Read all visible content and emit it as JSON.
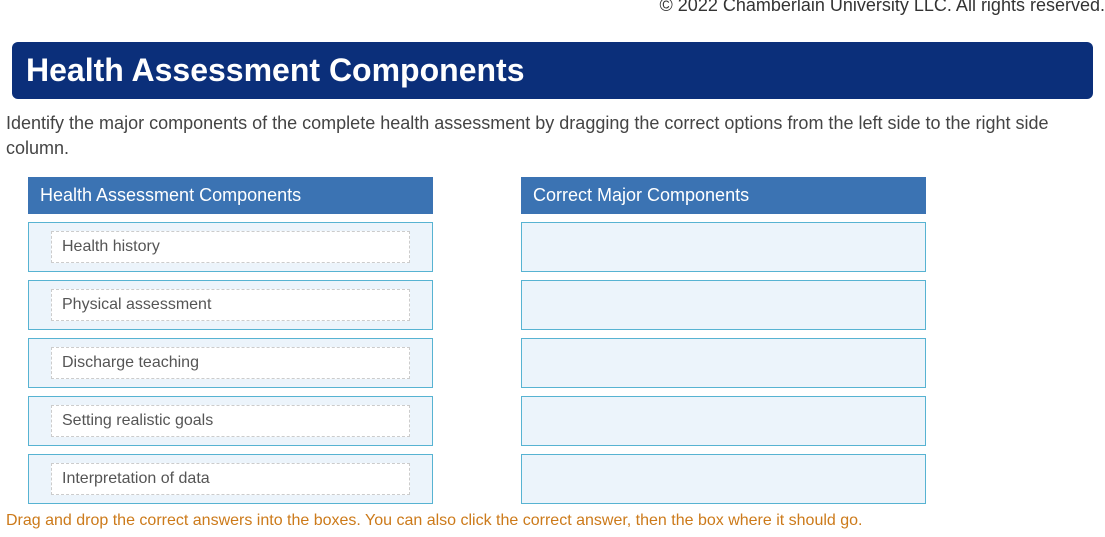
{
  "copyright": "© 2022 Chamberlain University LLC. All rights reserved.",
  "title": "Health Assessment Components",
  "instructions": "Identify the major components of the complete health assessment by dragging the correct options from the left side to the right side column.",
  "leftColumn": {
    "header": "Health Assessment Components",
    "items": [
      "Health history",
      "Physical assessment",
      "Discharge teaching",
      "Setting realistic goals",
      "Interpretation of data"
    ]
  },
  "rightColumn": {
    "header": "Correct Major Components",
    "slotCount": 5
  },
  "footerInstruction": "Drag and drop the correct answers into the boxes. You can also click the correct answer, then the box where it should go."
}
